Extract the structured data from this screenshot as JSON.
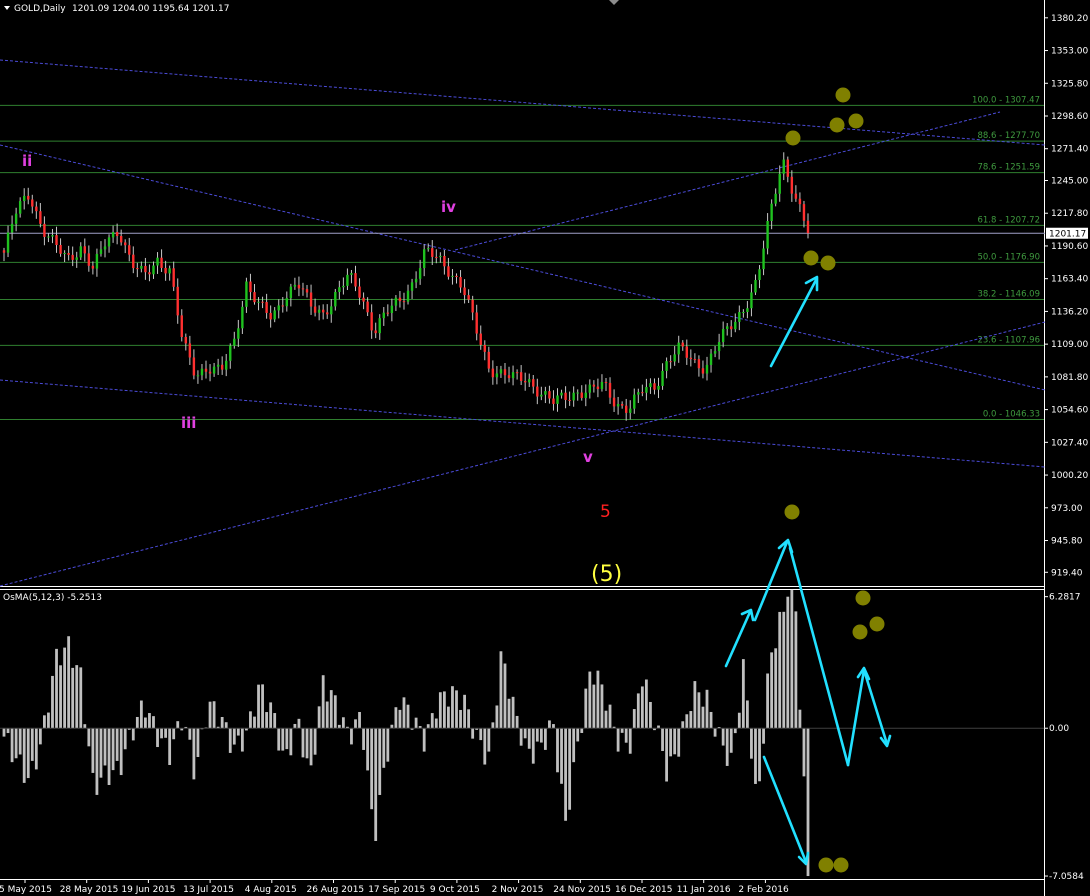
{
  "header": {
    "symbol": "GOLD,Daily",
    "ohlc": "1201.09 1204.00 1195.64 1201.17",
    "osma_label": "OsMA(5,12,3) -5.2513"
  },
  "price_tag": "1201.17",
  "chart_data": {
    "type": "candlestick",
    "title": "",
    "price_axis": {
      "min": 908,
      "max": 1395,
      "ticks": [
        "1380.20",
        "1353.00",
        "1325.80",
        "1298.60",
        "1271.40",
        "1245.00",
        "1217.80",
        "1190.60",
        "1163.40",
        "1136.20",
        "1109.00",
        "1081.80",
        "1054.60",
        "1027.40",
        "1000.20",
        "973.00",
        "945.80",
        "919.40"
      ]
    },
    "osma_axis": {
      "min": -7.2,
      "max": 6.6,
      "ticks": [
        "6.2817",
        "0.00",
        "-7.0584"
      ]
    },
    "dates": [
      "5 May 2015",
      "28 May 2015",
      "19 Jun 2015",
      "13 Jul 2015",
      "4 Aug 2015",
      "26 Aug 2015",
      "17 Sep 2015",
      "9 Oct 2015",
      "2 Nov 2015",
      "24 Nov 2015",
      "16 Dec 2015",
      "11 Jan 2016",
      "2 Feb 2016"
    ],
    "close_path": [
      1185,
      1220,
      1235,
      1205,
      1190,
      1180,
      1190,
      1170,
      1195,
      1205,
      1175,
      1165,
      1180,
      1170,
      1110,
      1085,
      1090,
      1085,
      1110,
      1160,
      1140,
      1130,
      1150,
      1160,
      1140,
      1135,
      1150,
      1165,
      1150,
      1120,
      1135,
      1145,
      1160,
      1185,
      1180,
      1170,
      1155,
      1120,
      1090,
      1085,
      1080,
      1080,
      1070,
      1060,
      1065,
      1070,
      1070,
      1075,
      1060,
      1055,
      1070,
      1075,
      1095,
      1105,
      1095,
      1090,
      1110,
      1125,
      1140,
      1160,
      1215,
      1265,
      1230,
      1201.17
    ],
    "last_price": 1201.17,
    "fib_levels": [
      {
        "label": "100.0 - 1307.47",
        "value": 1307.47
      },
      {
        "label": "88.6 - 1277.70",
        "value": 1277.7
      },
      {
        "label": "78.6 - 1251.59",
        "value": 1251.59
      },
      {
        "label": "61.8 - 1207.72",
        "value": 1207.72
      },
      {
        "label": "50.0 - 1176.90",
        "value": 1176.9
      },
      {
        "label": "38.2 - 1146.09",
        "value": 1146.09
      },
      {
        "label": "23.6 - 1107.96",
        "value": 1107.96
      },
      {
        "label": "0.0 - 1046.33",
        "value": 1046.33
      }
    ],
    "wave_labels": [
      {
        "text": "ii",
        "color": "#e040e0"
      },
      {
        "text": "iii",
        "color": "#e040e0"
      },
      {
        "text": "iv",
        "color": "#e040e0"
      },
      {
        "text": "v",
        "color": "#e040e0"
      },
      {
        "text": "5",
        "color": "#ff2020"
      },
      {
        "text": "(5)",
        "color": "#ffff40"
      }
    ],
    "osma_values": [
      -0.4,
      -1.5,
      -2.5,
      -0.5,
      3.2,
      4.0,
      2.5,
      -2.8,
      -2.2,
      -2.0,
      -0.2,
      1.2,
      -0.3,
      -1.2,
      0.6,
      -2.2,
      1.2,
      0.5,
      -1.0,
      -0.3,
      2.0,
      0.9,
      -1.7,
      0.4,
      -2.4,
      2.2,
      1.2,
      -0.4,
      0.6,
      -5.3,
      -1.2,
      1.5,
      0.5,
      -0.6,
      1.3,
      1.7,
      1.4,
      -0.4,
      -1.5,
      3.6,
      0.8,
      -1.2,
      -1.0,
      0.3,
      -4.6,
      -0.6,
      2.9,
      1.8,
      -0.5,
      -0.9,
      2.6,
      0.4,
      -2.2,
      -0.6,
      1.8,
      1.5,
      -0.4,
      -1.7,
      3.1,
      -4.0,
      3.3,
      5.5,
      6.28,
      -7.0584
    ],
    "colors": {
      "bull": "#1fc21f",
      "bear": "#ff3030",
      "wick": "#c8c8c8",
      "osma_bar": "#c0c0c0",
      "trendline": "#4b4bd8",
      "fib": "#2f7f2f",
      "arrow": "#22e0ff",
      "marker": "#808000"
    }
  }
}
